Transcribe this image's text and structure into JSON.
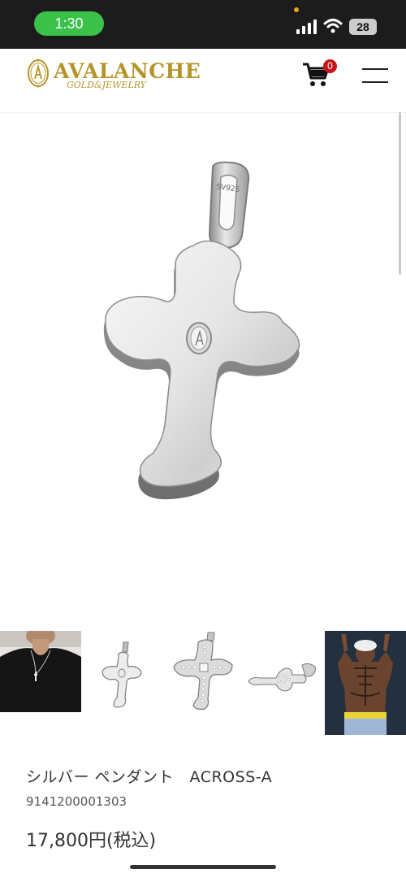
{
  "status_bar": {
    "time": "1:30",
    "battery": "28"
  },
  "header": {
    "brand_name": "AVALANCHE",
    "brand_subtitle": "GOLD&JEWELRY",
    "cart_count": "0",
    "brand_color": "#b59528",
    "badge_color": "#c8151b"
  },
  "product": {
    "name": "シルバー ペンダント　ACROSS-A",
    "code": "9141200001303",
    "price": "17,800円(税込)",
    "stamp": "SV925"
  },
  "gallery": {
    "thumbnails": [
      "worn-on-model",
      "cross-back",
      "cross-front-stones",
      "cross-side",
      "back-tattoo-photo"
    ]
  },
  "icons": [
    "signal-icon",
    "wifi-icon",
    "cart-icon",
    "menu-icon"
  ]
}
